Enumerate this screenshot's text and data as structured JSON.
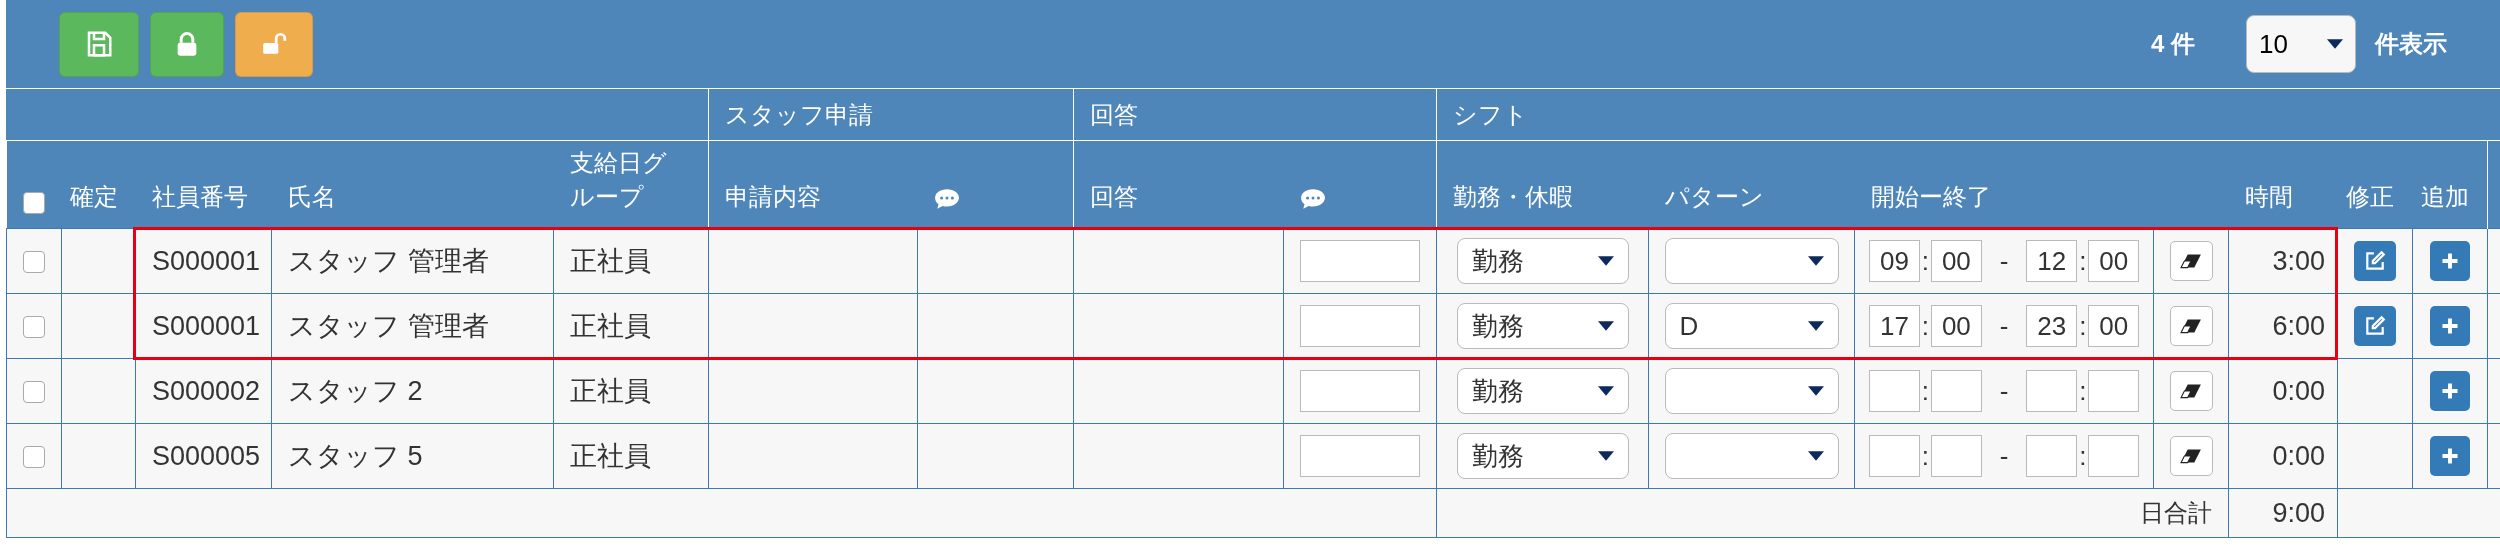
{
  "toolbar": {
    "buttons": [
      {
        "kind": "save",
        "color": "#5cb85c"
      },
      {
        "kind": "lock",
        "color": "#5cb85c"
      },
      {
        "kind": "unlock",
        "color": "#f0ad4e"
      }
    ],
    "count": "4 件",
    "page_size": "10",
    "page_size_label": "件表示"
  },
  "table": {
    "group_headers": [
      "スタッフ申請",
      "回答",
      "シフト"
    ],
    "select_all": {
      "checked": false
    },
    "columns": [
      {
        "kind": "text",
        "label": "確定"
      },
      {
        "kind": "text",
        "label": "社員番号"
      },
      {
        "kind": "text",
        "label": "氏名"
      },
      {
        "kind": "text",
        "label": "支給日グループ"
      },
      {
        "kind": "text",
        "label": "申請内容"
      },
      {
        "kind": "comment"
      },
      {
        "kind": "text",
        "label": "回答"
      },
      {
        "kind": "comment"
      },
      {
        "kind": "text",
        "label": "勤務・休暇"
      },
      {
        "kind": "text",
        "label": "パターン"
      },
      {
        "kind": "text",
        "label": "開始ー終了"
      },
      {
        "kind": "blank"
      },
      {
        "kind": "text",
        "label": "時間"
      },
      {
        "kind": "text",
        "label": "修正"
      },
      {
        "kind": "text",
        "label": "追加"
      }
    ],
    "rows": [
      {
        "checked": false,
        "highlighted": true,
        "employee_id": "S000001",
        "name": "スタッフ 管理者",
        "pay_group": "正社員",
        "work_type": "勤務",
        "start_hour": "09",
        "start_separator": ":",
        "start_minute": "00",
        "range_separator": "-",
        "end_hour": "12",
        "end_separator": ":",
        "end_minute": "00",
        "hours": "3:00",
        "editable": true
      },
      {
        "checked": false,
        "highlighted": true,
        "employee_id": "S000001",
        "name": "スタッフ 管理者",
        "pay_group": "正社員",
        "work_type": "勤務",
        "pattern": "D",
        "start_hour": "17",
        "start_separator": ":",
        "start_minute": "00",
        "range_separator": "-",
        "end_hour": "23",
        "end_separator": ":",
        "end_minute": "00",
        "hours": "6:00",
        "editable": true
      },
      {
        "checked": false,
        "highlighted": false,
        "employee_id": "S000002",
        "name": "スタッフ 2",
        "pay_group": "正社員",
        "work_type": "勤務",
        "start_separator": ":",
        "range_separator": "-",
        "end_separator": ":",
        "hours": "0:00",
        "editable": false
      },
      {
        "checked": false,
        "highlighted": false,
        "employee_id": "S000005",
        "name": "スタッフ 5",
        "pay_group": "正社員",
        "work_type": "勤務",
        "start_separator": ":",
        "range_separator": "-",
        "end_separator": ":",
        "hours": "0:00",
        "editable": false
      }
    ],
    "total": {
      "label": "日合計",
      "value": "9:00"
    }
  }
}
